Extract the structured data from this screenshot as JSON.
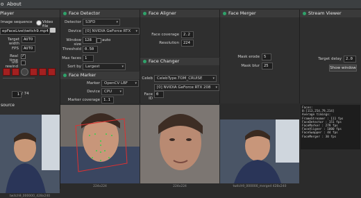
{
  "menu": {
    "partial": "o",
    "about": "About"
  },
  "player": {
    "title": "Player",
    "image_sequence": "Image sequence",
    "video_file": "Video file",
    "file_path": "epFaceLive\\twitch9.mp4",
    "target_width_label": "Target width",
    "target_width_value": "AUTO",
    "fps_label": "FPS",
    "fps_value": "AUTO",
    "realtime_label": "Real time",
    "autorewind_label": "uto rewind",
    "frame_value": "1",
    "frame_total": "/ 74",
    "source_label": "source",
    "caption": "twitch9_000000_428x240"
  },
  "face_detector": {
    "title": "Face Detector",
    "detector_label": "Detector",
    "detector_value": "S3FD",
    "device_label": "Device",
    "device_value": "[0] NVIDIA GeForce RTX",
    "window_size_label": "Window size",
    "window_size_value": "128",
    "auto_label": "auto",
    "threshold_label": "Threshold",
    "threshold_value": "0.50",
    "max_faces_label": "Max faces",
    "max_faces_value": "1",
    "sort_by_label": "Sort by",
    "sort_by_value": "Largest"
  },
  "face_marker": {
    "title": "Face Marker",
    "marker_label": "Marker",
    "marker_value": "OpenCV LBF",
    "device_label": "Device",
    "device_value": "CPU",
    "coverage_label": "Marker coverage",
    "coverage_value": "1.1",
    "caption": "224x224"
  },
  "face_aligner": {
    "title": "Face Aligner",
    "face_coverage_label": "Face coverage",
    "face_coverage_value": "2.2",
    "resolution_label": "Resolution",
    "resolution_value": "224"
  },
  "face_changer": {
    "title": "Face Changer",
    "model_label": "Celeb",
    "model_value": "CelebType.TOM_CRUISE",
    "device_value": "[0] NVIDIA GeForce RTX 208",
    "face_id_label": "Face ID",
    "face_id_value": "0",
    "caption": "224x224"
  },
  "face_merger": {
    "title": "Face Merger",
    "mask_erode_label": "Mask erode",
    "mask_erode_value": "5",
    "mask_blur_label": "Mask blur",
    "mask_blur_value": "25",
    "caption": "twitch9_000000_merged 428x240"
  },
  "stream_viewer": {
    "title": "Stream Viewer",
    "target_delay_label": "Target delay",
    "target_delay_value": "2.0",
    "show_window": "Show window"
  },
  "stats": {
    "lines": [
      "Faces:",
      "0:[113,254,79,214]",
      "Average timings:",
      "FrameStreamer : 111 fps",
      "FaceDetector  : 151 fps",
      "FaceMarker    : 279 fps",
      "FaceAligner   : 1000 fps",
      "FaceSwapper   : 44 fps",
      "FaceMerger    : 30 fps"
    ]
  },
  "colors": {
    "status_green": "#2fa26a",
    "record_red": "#a32020",
    "panel_bg": "#2f2f2f"
  }
}
